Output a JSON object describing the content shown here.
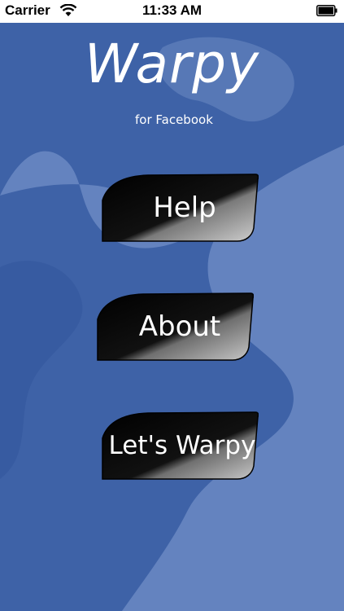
{
  "status_bar": {
    "carrier": "Carrier",
    "time": "11:33 AM",
    "wifi_icon": "wifi-icon",
    "battery_icon": "battery-icon"
  },
  "app": {
    "title": "Warpy",
    "subtitle": "for Facebook"
  },
  "menu": {
    "items": [
      {
        "label": "Help"
      },
      {
        "label": "About"
      },
      {
        "label": "Let's Warpy"
      }
    ]
  },
  "colors": {
    "background": "#3e62a7",
    "background_wave": "#6b8ac3",
    "button": "#0d0d0d",
    "button_highlight": "#bdbdbd",
    "text": "#ffffff"
  }
}
